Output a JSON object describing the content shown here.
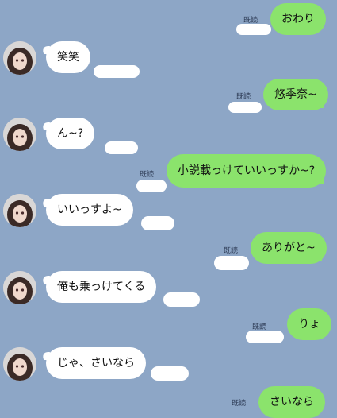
{
  "read_label": "既読",
  "messages": [
    {
      "side": "out",
      "text": "おわり"
    },
    {
      "side": "in",
      "text": "笑笑"
    },
    {
      "side": "out",
      "text": "悠季奈~"
    },
    {
      "side": "in",
      "text": "ん~?"
    },
    {
      "side": "out",
      "text": "小説載っけていいっすか~?"
    },
    {
      "side": "in",
      "text": "いいっすよ~"
    },
    {
      "side": "out",
      "text": "ありがと~"
    },
    {
      "side": "in",
      "text": "俺も乗っけてくる"
    },
    {
      "side": "out",
      "text": "りょ"
    },
    {
      "side": "in",
      "text": "じゃ、さいなら"
    },
    {
      "side": "out",
      "text": "さいなら"
    }
  ],
  "colors": {
    "background": "#8da6c6",
    "outgoing_bubble": "#8be36c",
    "incoming_bubble": "#ffffff"
  },
  "icons": {
    "avatar": "user-avatar-icon"
  }
}
